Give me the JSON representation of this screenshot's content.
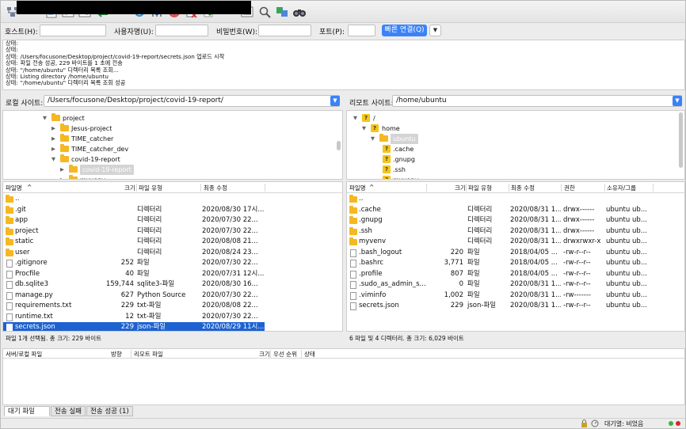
{
  "connect": {
    "host_label": "호스트(H):",
    "user_label": "사용자명(U):",
    "pass_label": "비밀번호(W):",
    "port_label": "포트(P):",
    "host_value": "",
    "user_value": "",
    "pass_value": "",
    "port_value": "",
    "quick_label": "빠른 연결(Q)",
    "dropdown_glyph": "▼"
  },
  "log": [
    {
      "status": "상태:",
      "text": ""
    },
    {
      "status": "상태:",
      "text": ""
    },
    {
      "status": "상태:",
      "text": "/Users/focusone/Desktop/project/covid-19-report/secrets.json 업로드 시작"
    },
    {
      "status": "상태:",
      "text": "파일 전송 성공, 229 바이트를 1 초에 전송"
    },
    {
      "status": "상태:",
      "text": "\"/home/ubuntu\" 디렉터리 목록 조회..."
    },
    {
      "status": "상태:",
      "text": "Listing directory /home/ubuntu"
    },
    {
      "status": "상태:",
      "text": "\"/home/ubuntu\" 디렉터리 목록 조회 성공"
    }
  ],
  "local": {
    "site_label": "로컬 사이트:",
    "path": "/Users/focusone/Desktop/project/covid-19-report/",
    "tree": [
      {
        "name": "project",
        "level": 0,
        "expanded": true
      },
      {
        "name": "Jesus-project",
        "level": 1,
        "expanded": false
      },
      {
        "name": "TIME_catcher",
        "level": 1,
        "expanded": false
      },
      {
        "name": "TIME_catcher_dev",
        "level": 1,
        "expanded": false
      },
      {
        "name": "covid-19-report",
        "level": 1,
        "expanded": true
      },
      {
        "name": "covid-19-report",
        "level": 2,
        "expanded": false,
        "selected": true
      },
      {
        "name": "myvenv",
        "level": 2,
        "expanded": false
      }
    ],
    "headers": {
      "name": "파일명",
      "size": "크기",
      "type": "파일 유형",
      "modified": "최종 수정"
    },
    "sort_glyph": "^",
    "files": [
      {
        "name": "..",
        "size": "",
        "type": "",
        "modified": "",
        "kind": "folder"
      },
      {
        "name": ".git",
        "size": "",
        "type": "디렉터리",
        "modified": "2020/08/30 17시...",
        "kind": "folder"
      },
      {
        "name": "app",
        "size": "",
        "type": "디렉터리",
        "modified": "2020/07/30 22...",
        "kind": "folder"
      },
      {
        "name": "project",
        "size": "",
        "type": "디렉터리",
        "modified": "2020/07/30 22...",
        "kind": "folder"
      },
      {
        "name": "static",
        "size": "",
        "type": "디렉터리",
        "modified": "2020/08/08 21...",
        "kind": "folder"
      },
      {
        "name": "user",
        "size": "",
        "type": "디렉터리",
        "modified": "2020/08/24 23...",
        "kind": "folder"
      },
      {
        "name": ".gitignore",
        "size": "252",
        "type": "파일",
        "modified": "2020/07/30 22...",
        "kind": "file"
      },
      {
        "name": "Procfile",
        "size": "40",
        "type": "파일",
        "modified": "2020/07/31 12시...",
        "kind": "file"
      },
      {
        "name": "db.sqlite3",
        "size": "159,744",
        "type": "sqlite3-파일",
        "modified": "2020/08/30 16...",
        "kind": "file"
      },
      {
        "name": "manage.py",
        "size": "627",
        "type": "Python Source",
        "modified": "2020/07/30 22...",
        "kind": "file"
      },
      {
        "name": "requirements.txt",
        "size": "229",
        "type": "txt-파일",
        "modified": "2020/08/08 22...",
        "kind": "file"
      },
      {
        "name": "runtime.txt",
        "size": "12",
        "type": "txt-파일",
        "modified": "2020/07/30 22...",
        "kind": "file"
      },
      {
        "name": "secrets.json",
        "size": "229",
        "type": "json-파일",
        "modified": "2020/08/29 11시...",
        "kind": "file",
        "selected": true
      }
    ],
    "status": "파일 1개 선택됨. 총 크기: 229 바이트"
  },
  "remote": {
    "site_label": "리모트 사이트:",
    "path": "/home/ubuntu",
    "tree": [
      {
        "name": "/",
        "level": 0,
        "expanded": true
      },
      {
        "name": "home",
        "level": 1,
        "expanded": true
      },
      {
        "name": "ubuntu",
        "level": 2,
        "expanded": true,
        "selected": true
      },
      {
        "name": ".cache",
        "level": 3
      },
      {
        "name": ".gnupg",
        "level": 3
      },
      {
        "name": ".ssh",
        "level": 3
      },
      {
        "name": "myvenv",
        "level": 3
      }
    ],
    "headers": {
      "name": "파일명",
      "size": "크기",
      "type": "파일 유형",
      "modified": "최종 수정",
      "perm": "권한",
      "owner": "소유자/그룹"
    },
    "sort_glyph": "^",
    "files": [
      {
        "name": "..",
        "size": "",
        "type": "",
        "modified": "",
        "perm": "",
        "owner": "",
        "kind": "folder"
      },
      {
        "name": ".cache",
        "size": "",
        "type": "디렉터리",
        "modified": "2020/08/31 1...",
        "perm": "drwx------",
        "owner": "ubuntu ub...",
        "kind": "folder"
      },
      {
        "name": ".gnupg",
        "size": "",
        "type": "디렉터리",
        "modified": "2020/08/31 1...",
        "perm": "drwx------",
        "owner": "ubuntu ub...",
        "kind": "folder"
      },
      {
        "name": ".ssh",
        "size": "",
        "type": "디렉터리",
        "modified": "2020/08/31 1...",
        "perm": "drwx------",
        "owner": "ubuntu ub...",
        "kind": "folder"
      },
      {
        "name": "myvenv",
        "size": "",
        "type": "디렉터리",
        "modified": "2020/08/31 1...",
        "perm": "drwxrwxr-x",
        "owner": "ubuntu ub...",
        "kind": "folder"
      },
      {
        "name": ".bash_logout",
        "size": "220",
        "type": "파일",
        "modified": "2018/04/05 ...",
        "perm": "-rw-r--r--",
        "owner": "ubuntu ub...",
        "kind": "file"
      },
      {
        "name": ".bashrc",
        "size": "3,771",
        "type": "파일",
        "modified": "2018/04/05 ...",
        "perm": "-rw-r--r--",
        "owner": "ubuntu ub...",
        "kind": "file"
      },
      {
        "name": ".profile",
        "size": "807",
        "type": "파일",
        "modified": "2018/04/05 ...",
        "perm": "-rw-r--r--",
        "owner": "ubuntu ub...",
        "kind": "file"
      },
      {
        "name": ".sudo_as_admin_s...",
        "size": "0",
        "type": "파일",
        "modified": "2020/08/31 1...",
        "perm": "-rw-r--r--",
        "owner": "ubuntu ub...",
        "kind": "file"
      },
      {
        "name": ".viminfo",
        "size": "1,002",
        "type": "파일",
        "modified": "2020/08/31 1...",
        "perm": "-rw-------",
        "owner": "ubuntu ub...",
        "kind": "file"
      },
      {
        "name": "secrets.json",
        "size": "229",
        "type": "json-파일",
        "modified": "2020/08/31 1...",
        "perm": "-rw-r--r--",
        "owner": "ubuntu ub...",
        "kind": "file"
      }
    ],
    "status": "6 파일 및 4 디렉터리. 총 크기: 6,029 바이트"
  },
  "queue": {
    "headers": {
      "server_file": "서버/로컬 파일",
      "direction": "방향",
      "remote_file": "리모트 파일",
      "size": "크기",
      "priority": "우선 순위",
      "status": "상태"
    },
    "tabs": [
      "대기 파일",
      "전송 실패",
      "전송 성공 (1)"
    ]
  },
  "bottom": {
    "queue_status": "대기열: 비었음",
    "led_colors": [
      "#3cb043",
      "#d62728"
    ]
  }
}
